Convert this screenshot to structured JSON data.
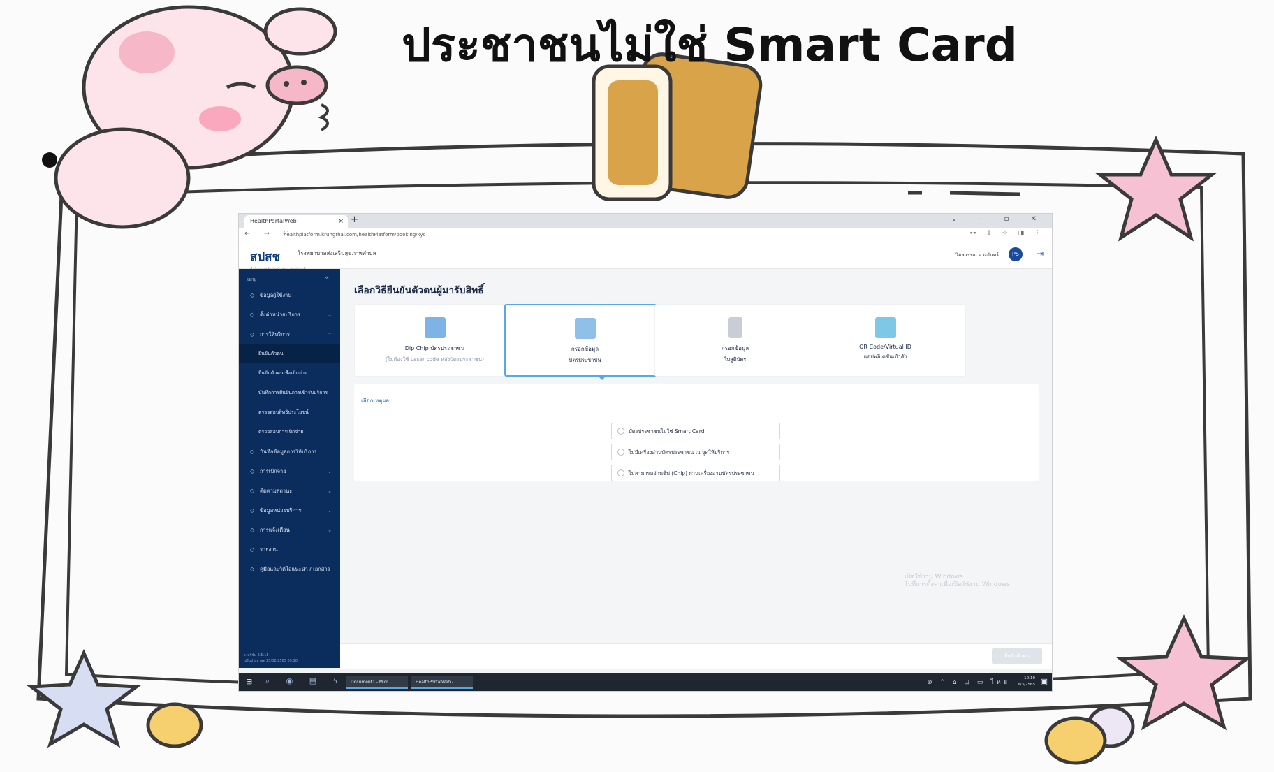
{
  "slide": {
    "title_th": "ประชาชนไม่ใช่",
    "title_en": "Smart Card"
  },
  "browser": {
    "tab_title": "HealthPortalWeb",
    "tab_close": "×",
    "new_tab": "+",
    "window_controls": "⌄ – ▫ ✕",
    "nav_buttons": "← → C",
    "url": "healthplatform.krungthai.com/healthPlatform/booking/kyc",
    "extensions": "⊶ ⇪ ☆ ◨ ⋮"
  },
  "app": {
    "logo": "สปสช",
    "logo_sub": "สำนักงานหลักประกันสุขภาพแห่งชาติ",
    "hospital": "โรงพยาบาลส่งเสริมสุขภาพตำบล",
    "user_name": "วิมลวรรณ ดวงจันทร์",
    "avatar_initials": "PS",
    "logout_icon": "⇥"
  },
  "sidebar": {
    "header": "เมนู",
    "collapse": "«",
    "items_top": [
      {
        "label": "ข้อมูลผู้ใช้งาน",
        "chevron": ""
      },
      {
        "label": "ตั้งค่าหน่วยบริการ",
        "chevron": "⌄"
      },
      {
        "label": "การให้บริการ",
        "chevron": "⌃"
      }
    ],
    "sub_items": [
      {
        "label": "ยืนยันตัวตน"
      },
      {
        "label": "ยืนยันตัวตนเพื่อเบิกจ่าย"
      },
      {
        "label": "บันทึกการยืนยันการเข้ารับบริการ"
      },
      {
        "label": "ตรวจสอบสิทธิประโยชน์"
      },
      {
        "label": "ตรวจสอบการเบิกจ่าย"
      }
    ],
    "items_bottom": [
      {
        "label": "บันทึกข้อมูลการให้บริการ",
        "chevron": ""
      },
      {
        "label": "การเบิกจ่าย",
        "chevron": "⌄"
      },
      {
        "label": "ติดตามสถานะ",
        "chevron": "⌄"
      },
      {
        "label": "ข้อมูลหน่วยบริการ",
        "chevron": "⌄"
      },
      {
        "label": "การแจ้งเตือน",
        "chevron": "⌄"
      },
      {
        "label": "รายงาน",
        "chevron": ""
      },
      {
        "label": "คู่มือและวิดีโอแนะนำ / เอกสาร",
        "chevron": ""
      }
    ],
    "version": "เวอร์ชัน 2.5.18",
    "version_date": "ปรับปรุงล่าสุด 25/02/2565 09:10"
  },
  "main": {
    "page_title": "เลือกวิธียืนยันตัวตนผู้มารับสิทธิ์",
    "cards": [
      {
        "line1": "Dip Chip บัตรประชาชน",
        "line2": "(ไม่ต้องใช้ Laser code หลังบัตรประชาชน)",
        "icon": "id-card-chip-icon",
        "selected": false,
        "icon_color": "#7fb3e8"
      },
      {
        "line1": "กรอกข้อมูล",
        "line2": "บัตรประชาชน",
        "icon": "id-card-form-icon",
        "selected": true,
        "icon_color": "#8fc0ea"
      },
      {
        "line1": "กรอกข้อมูล",
        "line2": "ใบสูติบัตร",
        "icon": "birth-certificate-icon",
        "selected": false,
        "icon_color": "#c9ced6"
      },
      {
        "line1": "QR Code/Virtual ID",
        "line2": "แอปพลิเคชันเป๋าตัง",
        "icon": "qr-code-icon",
        "selected": false,
        "icon_color": "#7fc7e6"
      }
    ],
    "reason_label": "เลือกเหตุผล",
    "reasons": [
      "บัตรประชาชนไม่ใช่ Smart Card",
      "ไม่มีเครื่องอ่านบัตรประชาชน ณ จุดให้บริการ",
      "ไม่สามารถอ่านชิป (Chip) ผ่านเครื่องอ่านบัตรประชาชน"
    ],
    "watermark_line1": "เปิดใช้งาน Windows",
    "watermark_line2": "ไปที่การตั้งค่าเพื่อเปิดใช้งาน Windows",
    "next_button": "ยืนยันตัวตน"
  },
  "taskbar": {
    "start": "⊞",
    "pinned": "⌕ ◉ ▤ ϟ",
    "apps": [
      "Document1 - Micr...",
      "HealthPortalWeb - ..."
    ],
    "tray": "⊛ ⌃ ⌂ ⊡ ▭ ไทย",
    "time": "10:10",
    "date": "6/3/2565",
    "notifications": "▣"
  }
}
